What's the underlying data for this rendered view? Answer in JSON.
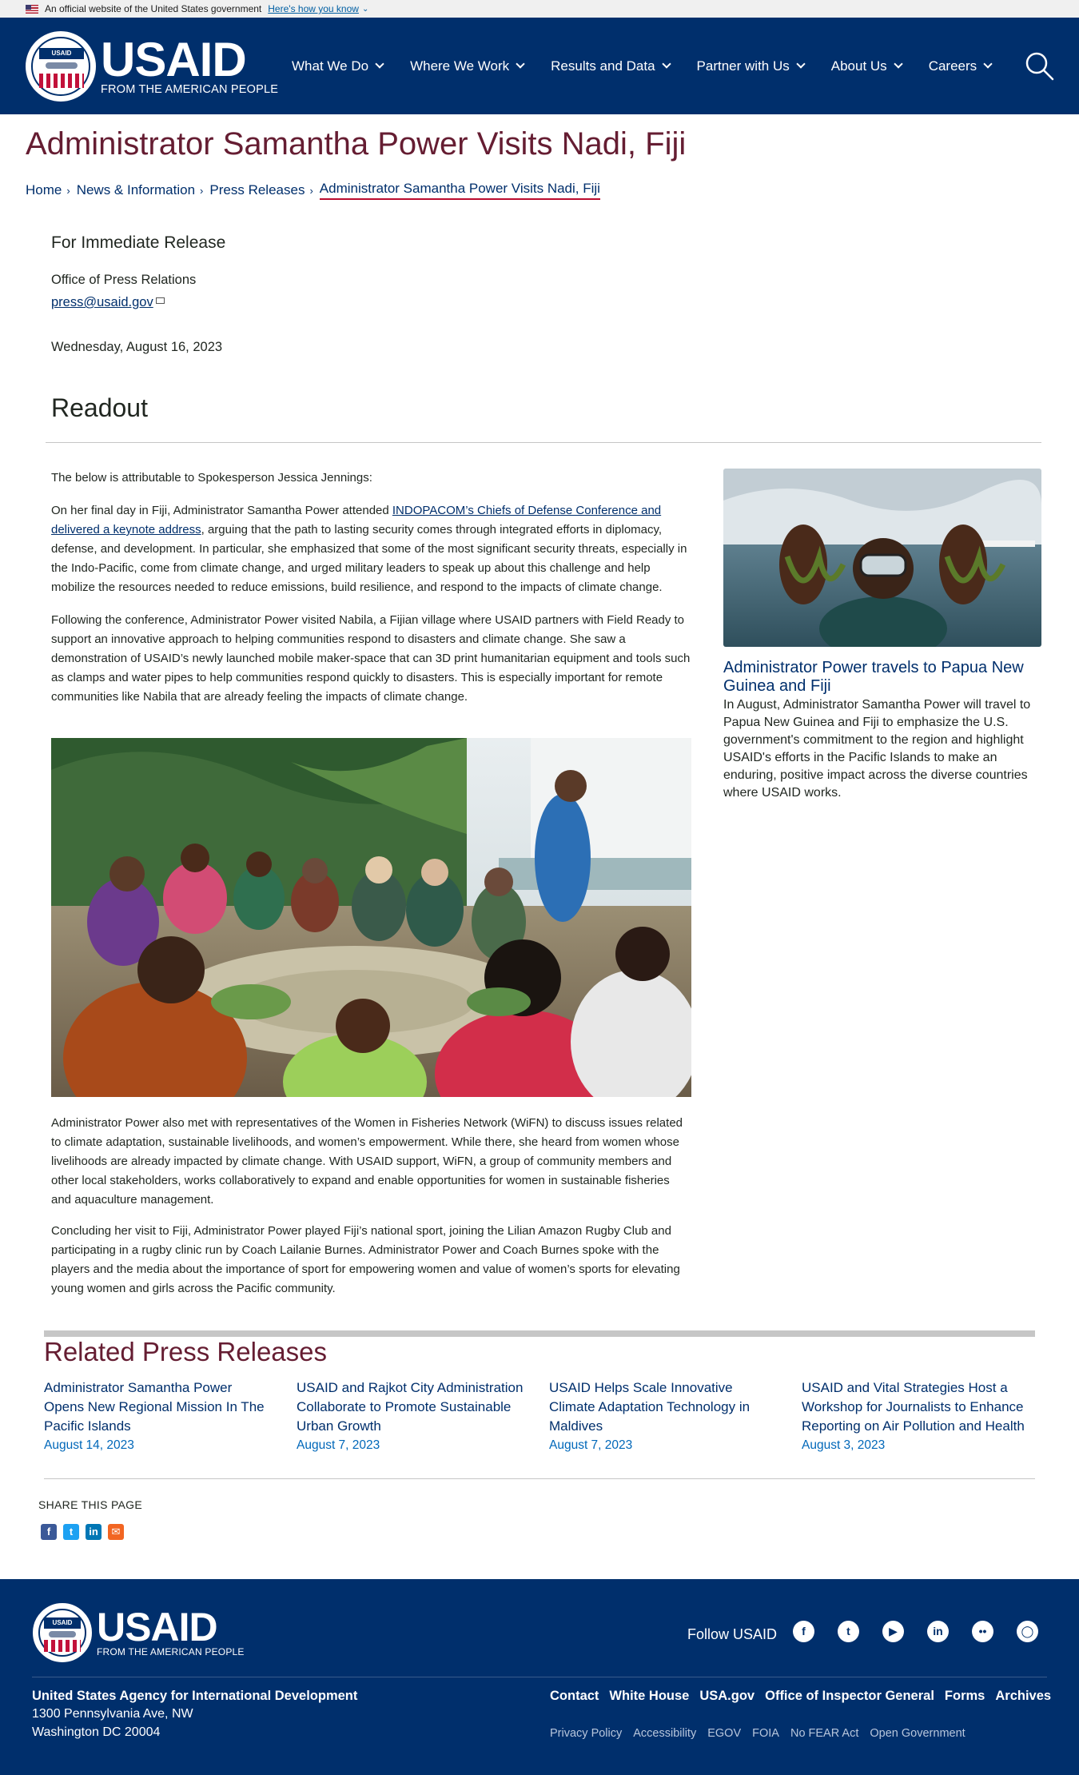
{
  "gov_banner": {
    "text": "An official website of the United States government",
    "how_link": "Here's how you know"
  },
  "logo": {
    "agency": "USAID",
    "tagline": "FROM THE AMERICAN PEOPLE",
    "seal_text": "USAID"
  },
  "nav": {
    "items": [
      "What We Do",
      "Where We Work",
      "Results and Data",
      "Partner with Us",
      "About Us",
      "Careers"
    ]
  },
  "page": {
    "title": "Administrator Samantha Power Visits Nadi, Fiji"
  },
  "breadcrumb": {
    "items": [
      "Home",
      "News & Information",
      "Press Releases",
      "Administrator Samantha Power Visits Nadi, Fiji"
    ]
  },
  "press": {
    "release_label": "For Immediate Release",
    "office": "Office of Press Relations",
    "email": "press@usaid.gov",
    "date": "Wednesday, August 16, 2023",
    "heading": "Readout"
  },
  "article": {
    "p1": "The below is attributable to Spokesperson Jessica Jennings:",
    "p2_pre": "On her final day in Fiji, Administrator Samantha Power attended ",
    "p2_link": "INDOPACOM’s Chiefs of Defense Conference and delivered a keynote address",
    "p2_post": ", arguing that the path to lasting security comes through integrated efforts in diplomacy, defense, and development. In particular, she emphasized that some of the most significant security threats, especially in the Indo-Pacific, come from climate change, and urged military leaders to speak up about this challenge and help mobilize the resources needed to reduce emissions, build resilience, and respond to the impacts of climate change.",
    "p3": "Following the conference, Administrator Power visited Nabila, a Fijian village where USAID partners with Field Ready to support an innovative approach to helping communities respond to disasters and climate change. She saw a demonstration of USAID’s newly launched mobile maker-space that can 3D print humanitarian equipment and tools such as clamps and water pipes to help communities respond quickly to disasters. This is especially important for remote communities like Nabila that are already feeling the impacts of climate change.",
    "p4": "Administrator Power also met with representatives of the Women in Fisheries Network (WiFN) to discuss issues related to climate adaptation, sustainable livelihoods, and women’s empowerment. While there, she heard from women whose livelihoods are already impacted by climate change. With USAID support, WiFN, a group of community members and other local stakeholders, works collaboratively to expand and enable opportunities for women in sustainable fisheries and aquaculture management.",
    "p5": "Concluding her visit to Fiji, Administrator Power played Fiji’s national sport, joining the Lilian Amazon Rugby Club and participating in a rugby clinic run by Coach Lailanie Burnes. Administrator Power and Coach Burnes spoke with the players and the media about the importance of sport for empowering women and value of women’s sports for elevating young women and girls across the Pacific community."
  },
  "sidebar": {
    "title": "Administrator Power travels to Papua New Guinea and Fiji",
    "description": "In August, Administrator Samantha Power will travel to Papua New Guinea and Fiji to emphasize the U.S. government's commitment to the region and highlight USAID's efforts in the Pacific Islands to make an enduring, positive impact across the diverse countries where USAID works."
  },
  "related": {
    "heading": "Related Press Releases",
    "items": [
      {
        "title": "Administrator Samantha Power Opens New Regional Mission In The Pacific Islands",
        "date": "August 14, 2023"
      },
      {
        "title": "USAID and Rajkot City Administration Collaborate to Promote Sustainable Urban Growth",
        "date": "August 7, 2023"
      },
      {
        "title": "USAID Helps Scale Innovative Climate Adaptation Technology in Maldives",
        "date": "August 7, 2023"
      },
      {
        "title": "USAID and Vital Strategies Host a Workshop for Journalists to Enhance Reporting on Air Pollution and Health",
        "date": "August 3, 2023"
      }
    ]
  },
  "share": {
    "label": "SHARE THIS PAGE"
  },
  "footer": {
    "follow": "Follow USAID",
    "agency": "United States Agency for International Development",
    "address1": "1300 Pennsylvania Ave, NW",
    "address2": "Washington DC 20004",
    "links": [
      "Contact",
      "White House",
      "USA.gov",
      "Office of Inspector General",
      "Forms",
      "Archives"
    ],
    "sublinks": [
      "Privacy Policy",
      "Accessibility",
      "EGOV",
      "FOIA",
      "No FEAR Act",
      "Open Government"
    ]
  },
  "colors": {
    "navy": "#002f6c",
    "maroon": "#651d32",
    "red": "#ba0c2f",
    "link_blue": "#0067b9"
  }
}
